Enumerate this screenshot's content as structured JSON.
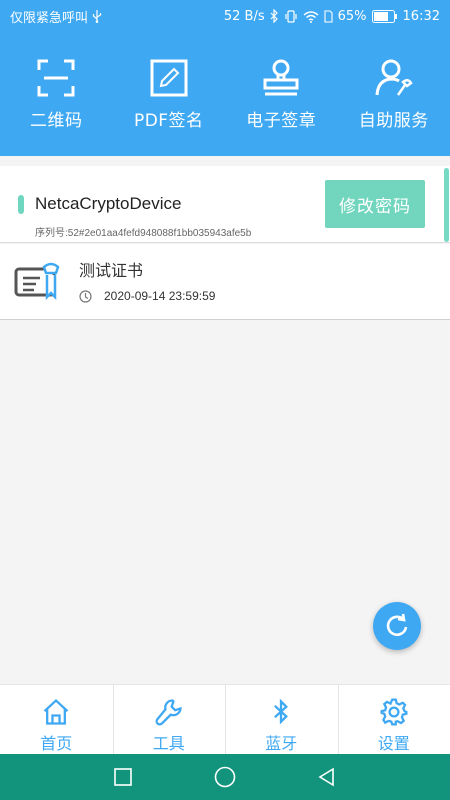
{
  "status_bar": {
    "carrier_text": "仅限紧急呼叫",
    "net_speed": "52 B/s",
    "battery": "65%",
    "time": "16:32"
  },
  "tools": [
    {
      "label": "二维码",
      "icon": "qr-scan-icon"
    },
    {
      "label": "PDF签名",
      "icon": "pen-sign-icon"
    },
    {
      "label": "电子签章",
      "icon": "stamp-icon"
    },
    {
      "label": "自助服务",
      "icon": "user-wrench-icon"
    }
  ],
  "device": {
    "name": "NetcaCryptoDevice",
    "serial": "序列号:52#2e01aa4fefd948088f1bb035943afe5b",
    "change_password_label": "修改密码"
  },
  "certificates": [
    {
      "title": "测试证书",
      "expiry": "2020-09-14 23:59:59"
    }
  ],
  "tabs": [
    {
      "label": "首页",
      "icon": "home-icon"
    },
    {
      "label": "工具",
      "icon": "wrench-icon"
    },
    {
      "label": "蓝牙",
      "icon": "bluetooth-icon"
    },
    {
      "label": "设置",
      "icon": "gear-icon"
    }
  ],
  "colors": {
    "primary": "#3fa8f2",
    "accent": "#72d6bf",
    "nav_bar": "#12937c"
  }
}
